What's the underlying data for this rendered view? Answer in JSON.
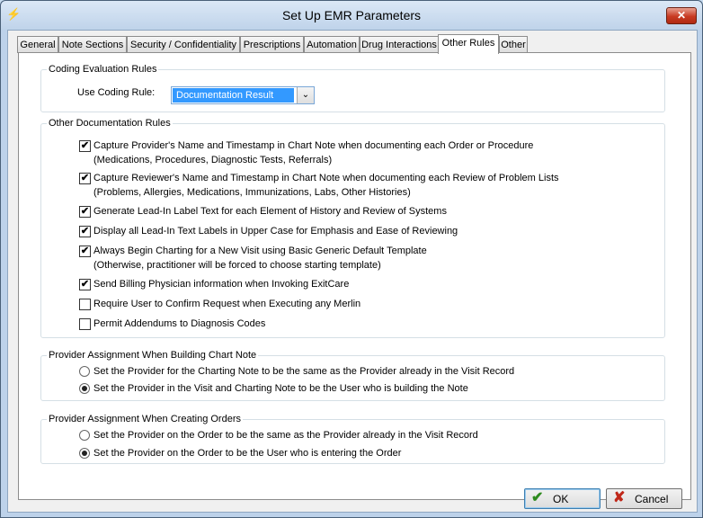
{
  "window": {
    "title": "Set Up EMR Parameters",
    "close_glyph": "✕",
    "app_icon_glyph": "⚡"
  },
  "tabs": [
    {
      "label": "General"
    },
    {
      "label": "Note Sections"
    },
    {
      "label": "Security / Confidentiality"
    },
    {
      "label": "Prescriptions"
    },
    {
      "label": "Automation"
    },
    {
      "label": "Drug Interactions"
    },
    {
      "label": "Other Rules",
      "active": true
    },
    {
      "label": "Other"
    }
  ],
  "coding": {
    "legend": "Coding Evaluation Rules",
    "label": "Use Coding Rule:",
    "value": "Documentation Result",
    "arrow": "⌄"
  },
  "docrules": {
    "legend": "Other Documentation Rules",
    "items": [
      {
        "line1": "Capture Provider's Name and Timestamp in Chart Note when documenting each Order or Procedure",
        "line2": "(Medications, Procedures, Diagnostic Tests, Referrals)",
        "checked": true
      },
      {
        "line1": "Capture Reviewer's Name and Timestamp in Chart Note when documenting each Review of Problem Lists",
        "line2": "(Problems, Allergies, Medications, Immunizations, Labs, Other Histories)",
        "checked": true
      },
      {
        "line1": "Generate Lead-In Label Text for each Element of History and Review of Systems",
        "checked": true
      },
      {
        "line1": "Display all Lead-In Text Labels in Upper Case for Emphasis and Ease of Reviewing",
        "checked": true
      },
      {
        "line1": "Always Begin Charting for a New Visit using Basic Generic Default Template",
        "line2": "(Otherwise, practitioner will be forced to choose starting template)",
        "checked": true
      },
      {
        "line1": "Send Billing Physician information when Invoking ExitCare",
        "checked": true
      },
      {
        "line1": "Require User to Confirm Request when Executing any Merlin",
        "checked": false
      },
      {
        "line1": "Permit Addendums to Diagnosis Codes",
        "checked": false
      }
    ],
    "check_glyph": "✔"
  },
  "chartnote": {
    "legend": "Provider Assignment When Building Chart Note",
    "options": [
      {
        "label": "Set the Provider for the Charting Note to be the same as the Provider already in the Visit Record",
        "selected": false
      },
      {
        "label": "Set the Provider in the Visit and Charting Note to be the User who is building the Note",
        "selected": true
      }
    ]
  },
  "orders": {
    "legend": "Provider Assignment When Creating Orders",
    "options": [
      {
        "label": "Set the Provider on the Order to be the same as the Provider already in the Visit Record",
        "selected": false
      },
      {
        "label": "Set the Provider on the Order to be the User who is entering the Order",
        "selected": true
      }
    ]
  },
  "buttons": {
    "ok_label": "OK",
    "ok_icon": "✔",
    "cancel_label": "Cancel",
    "cancel_icon": "✘"
  },
  "colors": {
    "ok_icon": "#2e8b1e",
    "cancel_icon": "#c0281a",
    "combo_highlight": "#3399ff"
  }
}
